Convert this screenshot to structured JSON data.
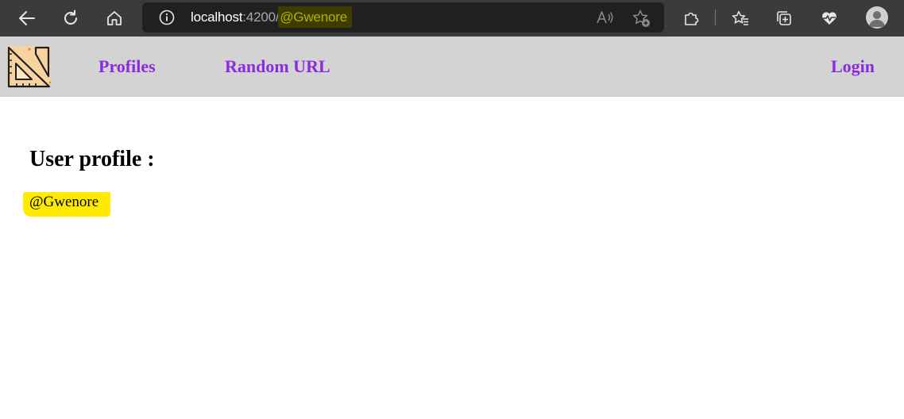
{
  "browser": {
    "url_host": "localhost",
    "url_port": ":4200/",
    "url_path": "@Gwenore",
    "icons": [
      "back-icon",
      "refresh-icon",
      "home-icon",
      "site-info-icon",
      "read-aloud-icon",
      "add-favorite-icon",
      "extensions-icon",
      "favorites-icon",
      "collections-icon",
      "browser-essentials-icon",
      "profile-avatar-icon"
    ]
  },
  "navbar": {
    "links": {
      "profiles": "Profiles",
      "random_url": "Random URL",
      "login": "Login"
    },
    "link_color": "#8a2be2",
    "background": "#d3d3d3"
  },
  "main": {
    "title": "User profile :",
    "handle": "@Gwenore",
    "highlight_color": "#ffea00"
  }
}
